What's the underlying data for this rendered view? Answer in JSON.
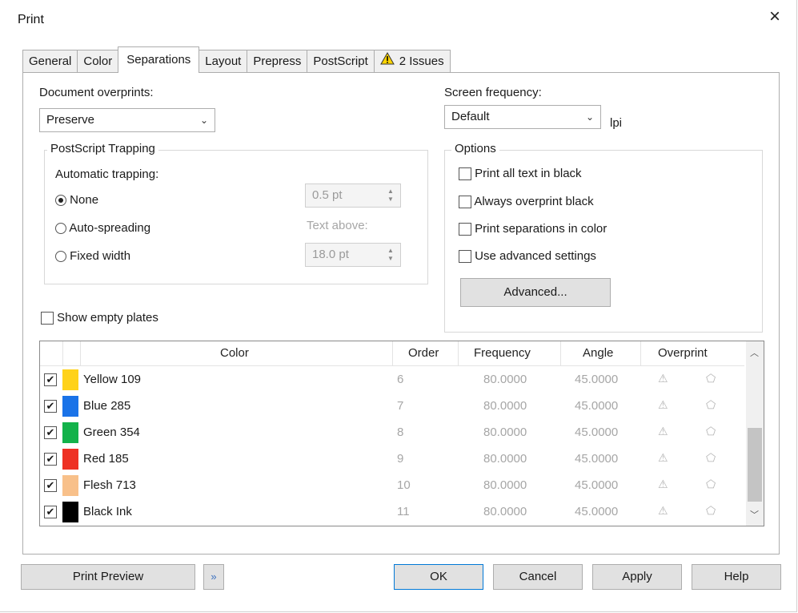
{
  "window": {
    "title": "Print",
    "close_icon": "×"
  },
  "tabs": [
    {
      "label": "General"
    },
    {
      "label": "Color"
    },
    {
      "label": "Separations",
      "active": true
    },
    {
      "label": "Layout"
    },
    {
      "label": "Prepress"
    },
    {
      "label": "PostScript"
    },
    {
      "label": "2 Issues",
      "icon": "warning-icon"
    }
  ],
  "doc_overprints": {
    "label": "Document overprints:",
    "value": "Preserve"
  },
  "screen_frequency": {
    "label": "Screen frequency:",
    "value": "Default",
    "unit": "lpi"
  },
  "trapping": {
    "group_title": "PostScript Trapping",
    "auto_label": "Automatic trapping:",
    "options": [
      {
        "label": "None",
        "selected": true
      },
      {
        "label": "Auto-spreading",
        "selected": false
      },
      {
        "label": "Fixed width",
        "selected": false
      }
    ],
    "spread_value": "0.5 pt",
    "text_above_label": "Text above:",
    "text_above_value": "18.0 pt"
  },
  "options": {
    "group_title": "Options",
    "items": [
      {
        "label": "Print all text in black",
        "checked": false
      },
      {
        "label": "Always overprint black",
        "checked": false
      },
      {
        "label": "Print separations in color",
        "checked": false
      },
      {
        "label": "Use advanced settings",
        "checked": false
      }
    ],
    "advanced_button": "Advanced..."
  },
  "show_empty_plates": {
    "label": "Show empty plates",
    "checked": false
  },
  "table": {
    "headers": [
      "Color",
      "Order",
      "Frequency",
      "Angle",
      "Overprint"
    ],
    "rows": [
      {
        "name": "Yellow 109",
        "order": "6",
        "frequency": "80.0000",
        "angle": "45.0000",
        "color": "#ffd21a",
        "checked": true
      },
      {
        "name": "Blue 285",
        "order": "7",
        "frequency": "80.0000",
        "angle": "45.0000",
        "color": "#1a73e8",
        "checked": true
      },
      {
        "name": "Green 354",
        "order": "8",
        "frequency": "80.0000",
        "angle": "45.0000",
        "color": "#13b24a",
        "checked": true
      },
      {
        "name": "Red 185",
        "order": "9",
        "frequency": "80.0000",
        "angle": "45.0000",
        "color": "#ee3124",
        "checked": true
      },
      {
        "name": "Flesh 713",
        "order": "10",
        "frequency": "80.0000",
        "angle": "45.0000",
        "color": "#f8c08a",
        "checked": true
      },
      {
        "name": "Black Ink",
        "order": "11",
        "frequency": "80.0000",
        "angle": "45.0000",
        "color": "#000000",
        "checked": true
      }
    ]
  },
  "buttons": {
    "print_preview": "Print Preview",
    "ok": "OK",
    "cancel": "Cancel",
    "apply": "Apply",
    "help": "Help"
  }
}
